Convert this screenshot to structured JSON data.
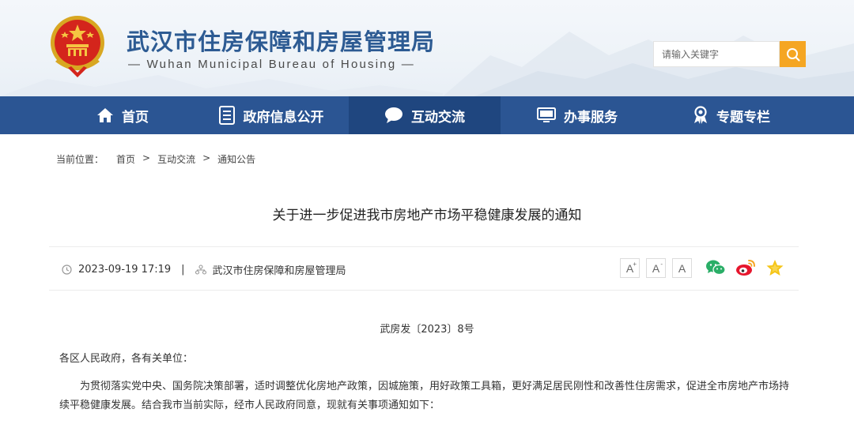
{
  "header": {
    "title": "武汉市住房保障和房屋管理局",
    "subtitle": "— Wuhan Municipal Bureau of Housing —",
    "search_placeholder": "请输入关键字",
    "colors": {
      "title": "#2d5b93",
      "search_button": "#f5a623"
    }
  },
  "nav": {
    "items": [
      {
        "label": "首页",
        "icon": "home-icon"
      },
      {
        "label": "政府信息公开",
        "icon": "document-list-icon"
      },
      {
        "label": "互动交流",
        "icon": "chat-bubble-icon",
        "active": true
      },
      {
        "label": "办事服务",
        "icon": "monitor-icon"
      },
      {
        "label": "专题专栏",
        "icon": "award-ribbon-icon"
      }
    ],
    "colors": {
      "background": "#2b5593",
      "active": "#1f467f"
    }
  },
  "breadcrumb": {
    "label": "当前位置：",
    "items": [
      "首页",
      "互动交流",
      "通知公告"
    ],
    "separator": ">"
  },
  "article": {
    "title": "关于进一步促进我市房地产市场平稳健康发展的通知",
    "date": "2023-09-19 17:19",
    "meta_divider": "|",
    "source": "武汉市住房保障和房屋管理局",
    "font_sizes": [
      "A",
      "A",
      "A"
    ],
    "share": [
      "wechat-icon",
      "weibo-icon",
      "favorite-star-icon"
    ],
    "doc_number": "武房发〔2023〕8号",
    "salutation": "各区人民政府，各有关单位：",
    "paragraph": "为贯彻落实党中央、国务院决策部署，适时调整优化房地产政策，因城施策，用好政策工具箱，更好满足居民刚性和改善性住房需求，促进全市房地产市场持续平稳健康发展。结合我市当前实际，经市人民政府同意，现就有关事项通知如下："
  }
}
